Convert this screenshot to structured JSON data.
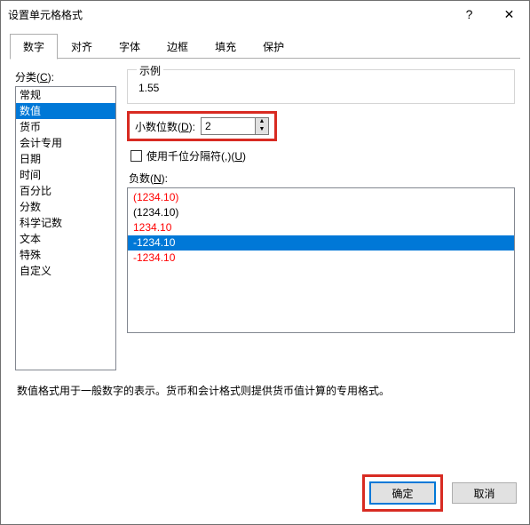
{
  "titlebar": {
    "title": "设置单元格格式",
    "help_glyph": "?",
    "close_glyph": "✕"
  },
  "tabs": [
    {
      "label": "数字",
      "active": true
    },
    {
      "label": "对齐",
      "active": false
    },
    {
      "label": "字体",
      "active": false
    },
    {
      "label": "边框",
      "active": false
    },
    {
      "label": "填充",
      "active": false
    },
    {
      "label": "保护",
      "active": false
    }
  ],
  "category": {
    "label_prefix": "分类(",
    "label_key": "C",
    "label_suffix": "):",
    "items": [
      "常规",
      "数值",
      "货币",
      "会计专用",
      "日期",
      "时间",
      "百分比",
      "分数",
      "科学记数",
      "文本",
      "特殊",
      "自定义"
    ],
    "selected_index": 1
  },
  "sample": {
    "label": "示例",
    "value": "1.55"
  },
  "decimal": {
    "label_prefix": "小数位数(",
    "label_key": "D",
    "label_suffix": "):",
    "value": "2"
  },
  "thousands": {
    "label_prefix": "使用千位分隔符(,)(",
    "label_key": "U",
    "label_suffix": ")",
    "checked": false
  },
  "negative": {
    "label_prefix": "负数(",
    "label_key": "N",
    "label_suffix": "):",
    "items": [
      {
        "text": "(1234.10)",
        "color": "red"
      },
      {
        "text": "(1234.10)",
        "color": "black"
      },
      {
        "text": "1234.10",
        "color": "red"
      },
      {
        "text": "-1234.10",
        "color": "black",
        "selected": true
      },
      {
        "text": "-1234.10",
        "color": "red"
      }
    ]
  },
  "description": "数值格式用于一般数字的表示。货币和会计格式则提供货币值计算的专用格式。",
  "buttons": {
    "ok": "确定",
    "cancel": "取消"
  },
  "highlight_color": "#d82b22"
}
